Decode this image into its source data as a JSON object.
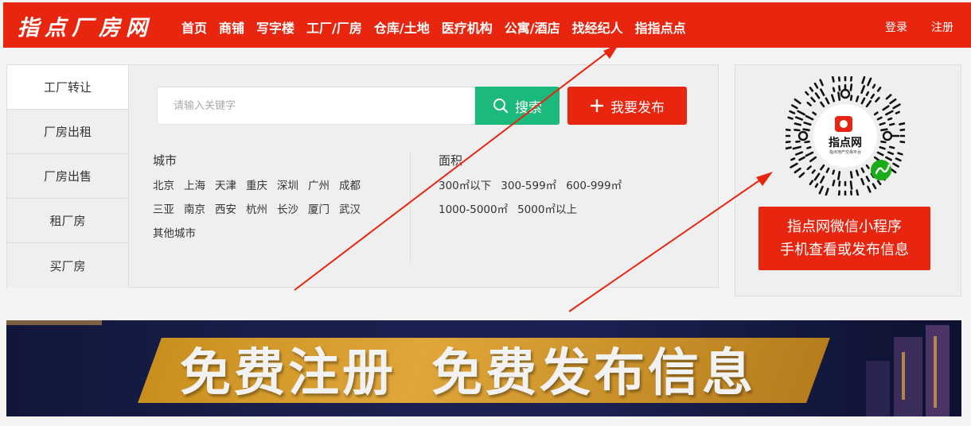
{
  "logo": "指点厂房网",
  "nav": [
    "首页",
    "商铺",
    "写字楼",
    "工厂/厂房",
    "仓库/土地",
    "医疗机构",
    "公寓/酒店",
    "找经纪人",
    "指指点点"
  ],
  "auth": {
    "login": "登录",
    "register": "注册"
  },
  "side_tabs": [
    "工厂转让",
    "厂房出租",
    "厂房出售",
    "租厂房",
    "买厂房"
  ],
  "search": {
    "placeholder": "请输入关键字",
    "value": "",
    "search_label": "搜索",
    "publish_label": "我要发布"
  },
  "city": {
    "title": "城市",
    "rows": [
      [
        "北京",
        "上海",
        "天津",
        "重庆",
        "深圳",
        "广州",
        "成都"
      ],
      [
        "三亚",
        "南京",
        "西安",
        "杭州",
        "长沙",
        "厦门",
        "武汉"
      ],
      [
        "其他城市"
      ]
    ]
  },
  "area": {
    "title": "面积",
    "rows": [
      [
        "300㎡以下",
        "300-599㎡",
        "600-999㎡"
      ],
      [
        "1000-5000㎡",
        "5000㎡以上"
      ]
    ]
  },
  "qr": {
    "logo_text": "指点网",
    "sub_text": "指点地产交易平台",
    "line1": "指点网微信小程序",
    "line2": "手机查看或发布信息"
  },
  "banner": {
    "part1": "免费注册",
    "part2": "免费发布信息"
  },
  "colors": {
    "brand_red": "#e8250f",
    "search_green": "#1bba7c",
    "banner_gold": "#d89a2c"
  }
}
